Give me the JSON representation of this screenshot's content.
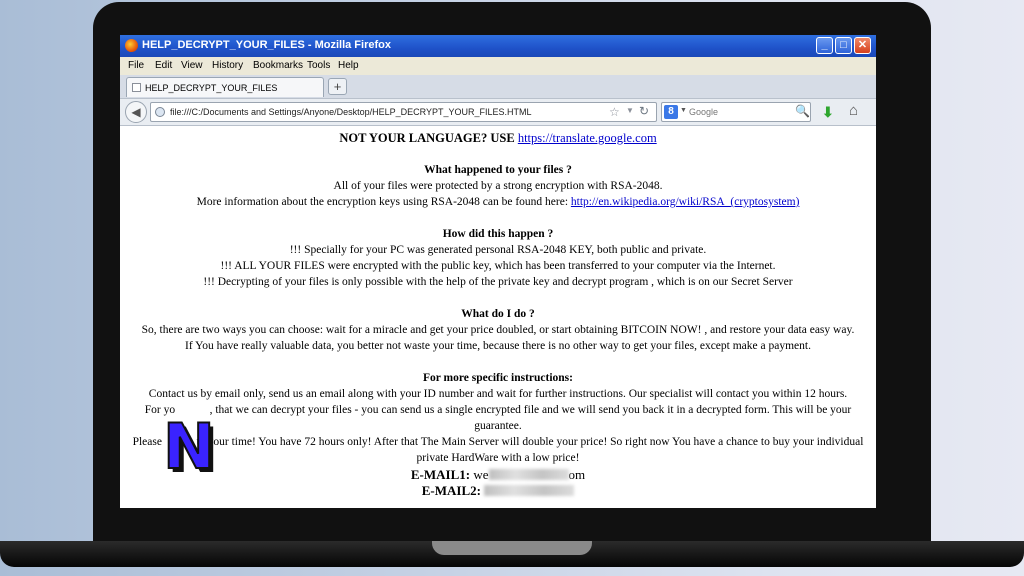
{
  "window": {
    "title": "HELP_DECRYPT_YOUR_FILES - Mozilla Firefox",
    "controls": {
      "minimize": "_",
      "maximize": "□",
      "close": "✕"
    }
  },
  "menu": [
    "File",
    "Edit",
    "View",
    "History",
    "Bookmarks",
    "Tools",
    "Help"
  ],
  "tab": {
    "label": "HELP_DECRYPT_YOUR_FILES",
    "new_tab": "+"
  },
  "navbar": {
    "url": "file:///C:/Documents and Settings/Anyone/Desktop/HELP_DECRYPT_YOUR_FILES.HTML",
    "search_placeholder": "Google",
    "search_engine_badge": "8"
  },
  "page": {
    "language_prefix": "NOT YOUR LANGUAGE? USE ",
    "language_link": "https://translate.google.com",
    "h1": "What happened to your files ?",
    "p1a": "All of your files were protected by a strong encryption with RSA-2048.",
    "p1b_prefix": "More information about the encryption keys using RSA-2048 can be found here: ",
    "p1b_link": "http://en.wikipedia.org/wiki/RSA_(cryptosystem)",
    "h2": "How did this happen ?",
    "p2a": "!!! Specially for your PC was generated personal RSA-2048 KEY, both public and private.",
    "p2b": "!!! ALL YOUR FILES were encrypted with the public key, which has been transferred to your computer via the Internet.",
    "p2c": "!!! Decrypting of your files is only possible with the help of the private key and decrypt program , which is on our Secret Server",
    "h3": "What do I do ?",
    "p3a": "So, there are two ways you can choose: wait for a miracle and get your price doubled, or start obtaining BITCOIN NOW! , and restore your data easy way.",
    "p3b": "If You have really valuable data, you better not waste your time, because there is no other way to get your files, except make a payment.",
    "h4": "For more specific instructions:",
    "p4a": "Contact us by email only, send us an email along with your ID number and wait for further instructions. Our specialist will contact you within 12 hours.",
    "p4b": "For yo            , that we can decrypt your files - you can send us a single encrypted file and we will send you back it in a decrypted form. This will be your guarantee.",
    "p4c": "Please            te your time! You have 72 hours only! After that The Main Server will double your price! So right now You have a chance to buy your individual private HardWare with a low price!",
    "email1_label": "E-MAIL1:",
    "email1_start": " we",
    "email1_end": "om",
    "email2_label": "E-MAIL2:"
  },
  "overlay_logo": "N"
}
